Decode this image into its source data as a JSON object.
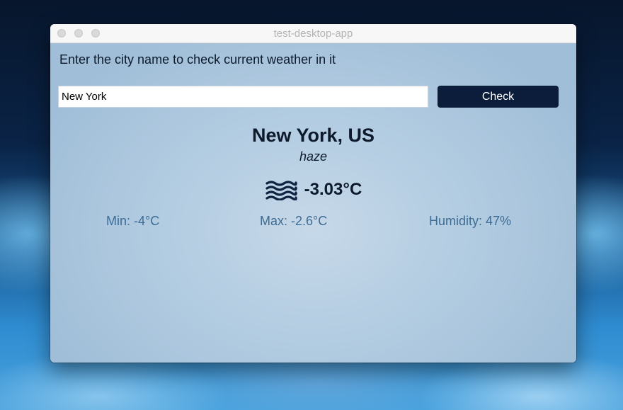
{
  "window": {
    "title": "test-desktop-app"
  },
  "form": {
    "instruction": "Enter the city name to check current weather in it",
    "city_value": "New York",
    "check_label": "Check"
  },
  "weather": {
    "location": "New York, US",
    "condition": "haze",
    "icon": "haze-icon",
    "temperature": "-3.03°C",
    "min": "Min: -4°C",
    "max": "Max: -2.6°C",
    "humidity": "Humidity: 47%"
  },
  "colors": {
    "button_bg": "#0b1d3a",
    "heading_text": "#0c1a2c",
    "stat_text": "#3f6c94"
  }
}
